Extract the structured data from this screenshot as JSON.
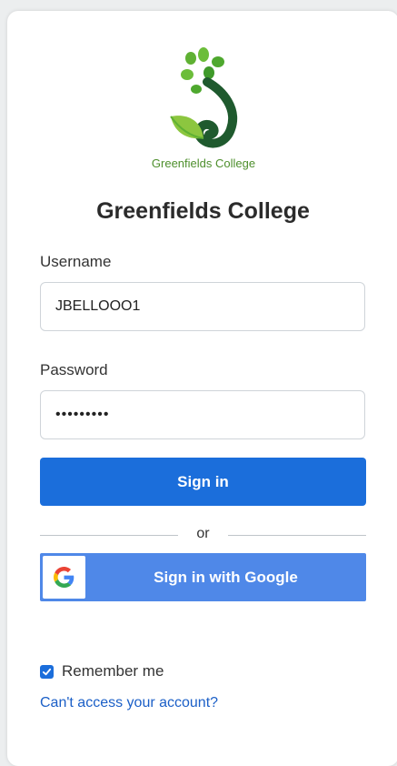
{
  "brand": {
    "logo_text": "Greenfields College",
    "title": "Greenfields College",
    "accent": "#1b6edb",
    "google_blue": "#4f88e8",
    "logo_green": "#5fb133",
    "logo_dark": "#1f5a2e"
  },
  "form": {
    "username_label": "Username",
    "username_value": "JBELLOOO1",
    "password_label": "Password",
    "password_value": "•••••••••",
    "sign_in_label": "Sign in",
    "divider_text": "or",
    "google_label": "Sign in with Google",
    "google_icon": "google-g-icon",
    "remember_label": "Remember me",
    "remember_checked": true,
    "forgot_link": "Can't access your account?"
  }
}
